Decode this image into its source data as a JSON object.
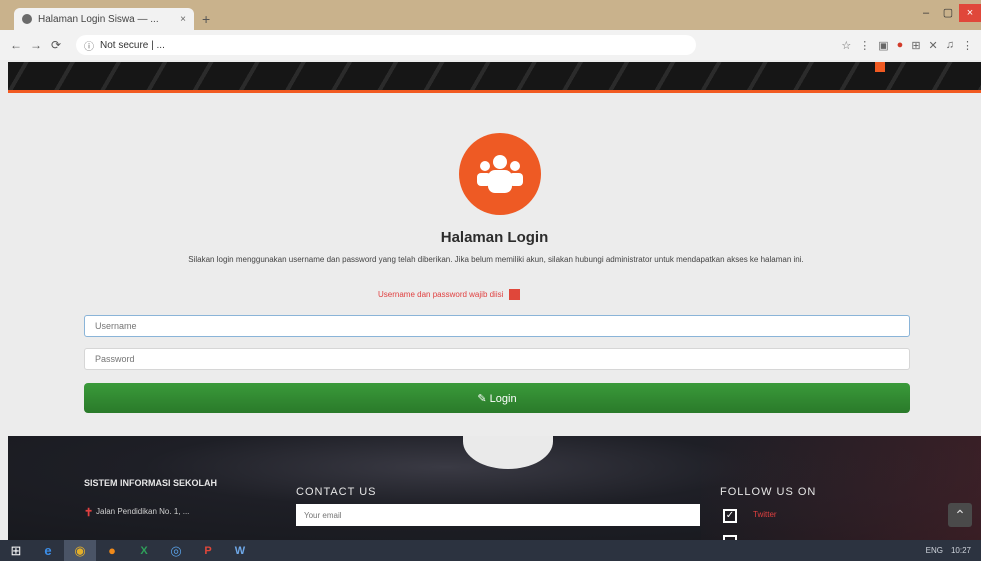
{
  "browser": {
    "tab_title": "Halaman Login Siswa — ...",
    "tab_close": "×",
    "new_tab": "+",
    "window_controls": {
      "minimize": "–",
      "maximize": "▢",
      "close": "×"
    },
    "nav": {
      "back": "←",
      "forward": "→",
      "reload": "⟳"
    },
    "address_lock": "ⓘ",
    "address": "Not secure | ...",
    "extension_icons": [
      "☆",
      "⋮",
      "▣",
      "●",
      "⊞",
      "✕",
      "♫",
      "⋮"
    ]
  },
  "login": {
    "title": "Halaman Login",
    "description": "Silakan login menggunakan username dan password yang telah diberikan. Jika belum memiliki akun, silakan hubungi administrator untuk mendapatkan akses ke halaman ini.",
    "notice": "Username dan password wajib diisi",
    "username_placeholder": "Username",
    "password_placeholder": "Password",
    "login_button": "✎ Login"
  },
  "footer": {
    "school_name": "SISTEM INFORMASI SEKOLAH",
    "address_icon": "✝",
    "address": "Jalan Pendidikan No. 1, ...",
    "contact_title": "CONTACT US",
    "contact_placeholder": "Your email",
    "follow_title": "FOLLOW US ON",
    "twitter": "Twitter",
    "scroll_top": "⌃"
  },
  "taskbar": {
    "start": "⊞",
    "ie": "e",
    "chrome": "◉",
    "firefox": "●",
    "excel": "X",
    "edge": "◎",
    "ppt": "P",
    "word": "W",
    "tray_lang": "ENG",
    "clock": "10:27"
  },
  "colors": {
    "accent": "#f15a22",
    "login_button": "#2e8b2e",
    "footer_bg": "#1e1f26"
  }
}
